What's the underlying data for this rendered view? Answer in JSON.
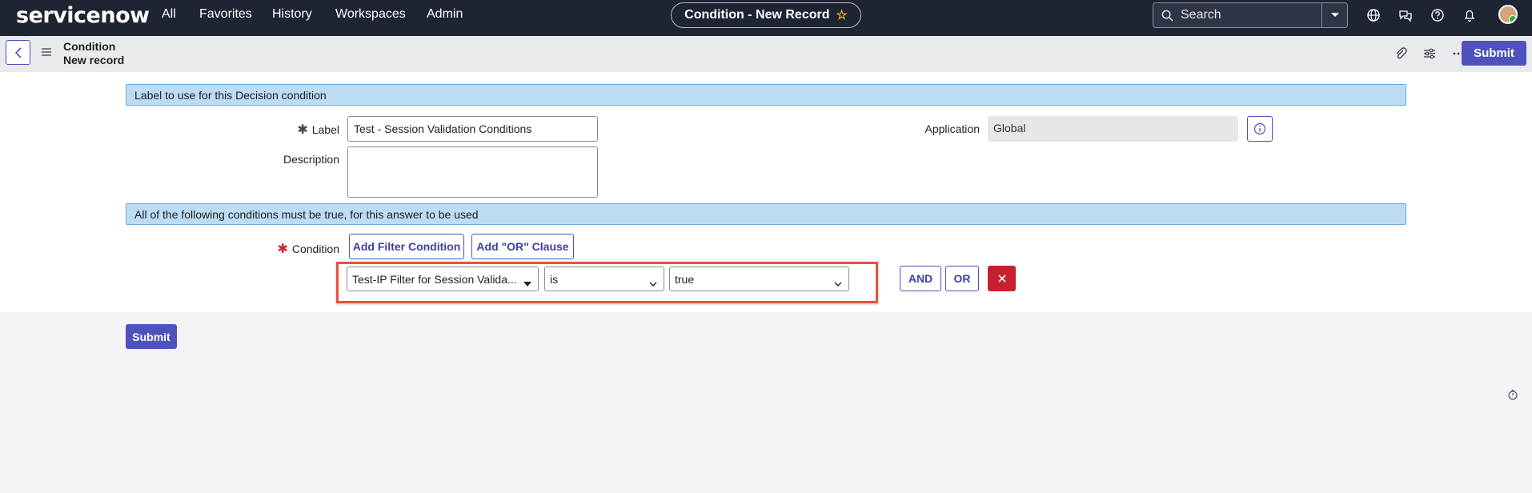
{
  "brand": "servicenow",
  "nav": {
    "items": [
      "All",
      "Favorites",
      "History",
      "Workspaces",
      "Admin"
    ],
    "record_title": "Condition - New Record",
    "search_placeholder": "Search"
  },
  "subheader": {
    "title": "Condition",
    "subtitle": "New record",
    "submit_label": "Submit"
  },
  "sections": {
    "label_section": "Label to use for this Decision condition",
    "condition_section": "All of the following conditions must be true, for this answer to be used"
  },
  "fields": {
    "label_label": "Label",
    "label_value": "Test - Session Validation Conditions",
    "description_label": "Description",
    "description_value": "",
    "application_label": "Application",
    "application_value": "Global",
    "condition_label": "Condition"
  },
  "condition_builder": {
    "add_filter_label": "Add Filter Condition",
    "add_or_label": "Add \"OR\" Clause",
    "field_value": "Test-IP Filter for Session Valida...",
    "operator_value": "is",
    "value_value": "true",
    "and_label": "AND",
    "or_label": "OR"
  },
  "footer": {
    "submit_label": "Submit"
  },
  "colors": {
    "primary": "#4f52bd",
    "header_bg": "#1f2433",
    "section_bg": "#bcdcf4",
    "delete": "#c8202f",
    "highlight": "#e5533d"
  }
}
